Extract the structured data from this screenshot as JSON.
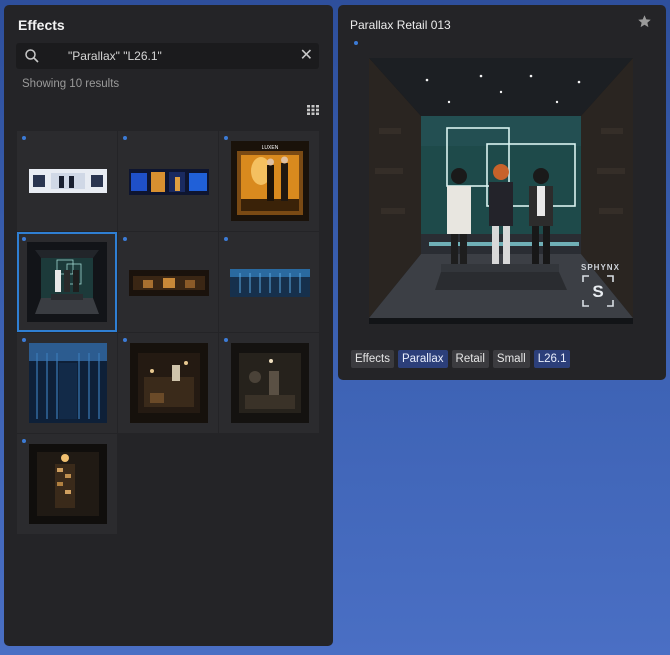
{
  "left": {
    "title": "Effects",
    "search_value": "\"Parallax\" \"L26.1\"",
    "results": "Showing 10 results",
    "thumbnails": [
      {
        "name": "thumb-1"
      },
      {
        "name": "thumb-2"
      },
      {
        "name": "thumb-3",
        "caption": "LUXEN"
      },
      {
        "name": "thumb-4",
        "selected": true
      },
      {
        "name": "thumb-5"
      },
      {
        "name": "thumb-6"
      },
      {
        "name": "thumb-7"
      },
      {
        "name": "thumb-8"
      },
      {
        "name": "thumb-9"
      },
      {
        "name": "thumb-10"
      }
    ]
  },
  "detail": {
    "title": "Parallax Retail 013",
    "brand": "SPHYNX",
    "brand_letter": "S",
    "tags": [
      {
        "label": "Effects",
        "highlight": false
      },
      {
        "label": "Parallax",
        "highlight": true
      },
      {
        "label": "Retail",
        "highlight": false
      },
      {
        "label": "Small",
        "highlight": false
      },
      {
        "label": "L26.1",
        "highlight": true
      }
    ]
  },
  "colors": {
    "accent": "#2f7fd3",
    "panel": "#242427",
    "tag_highlight": "#2c3f7a"
  }
}
